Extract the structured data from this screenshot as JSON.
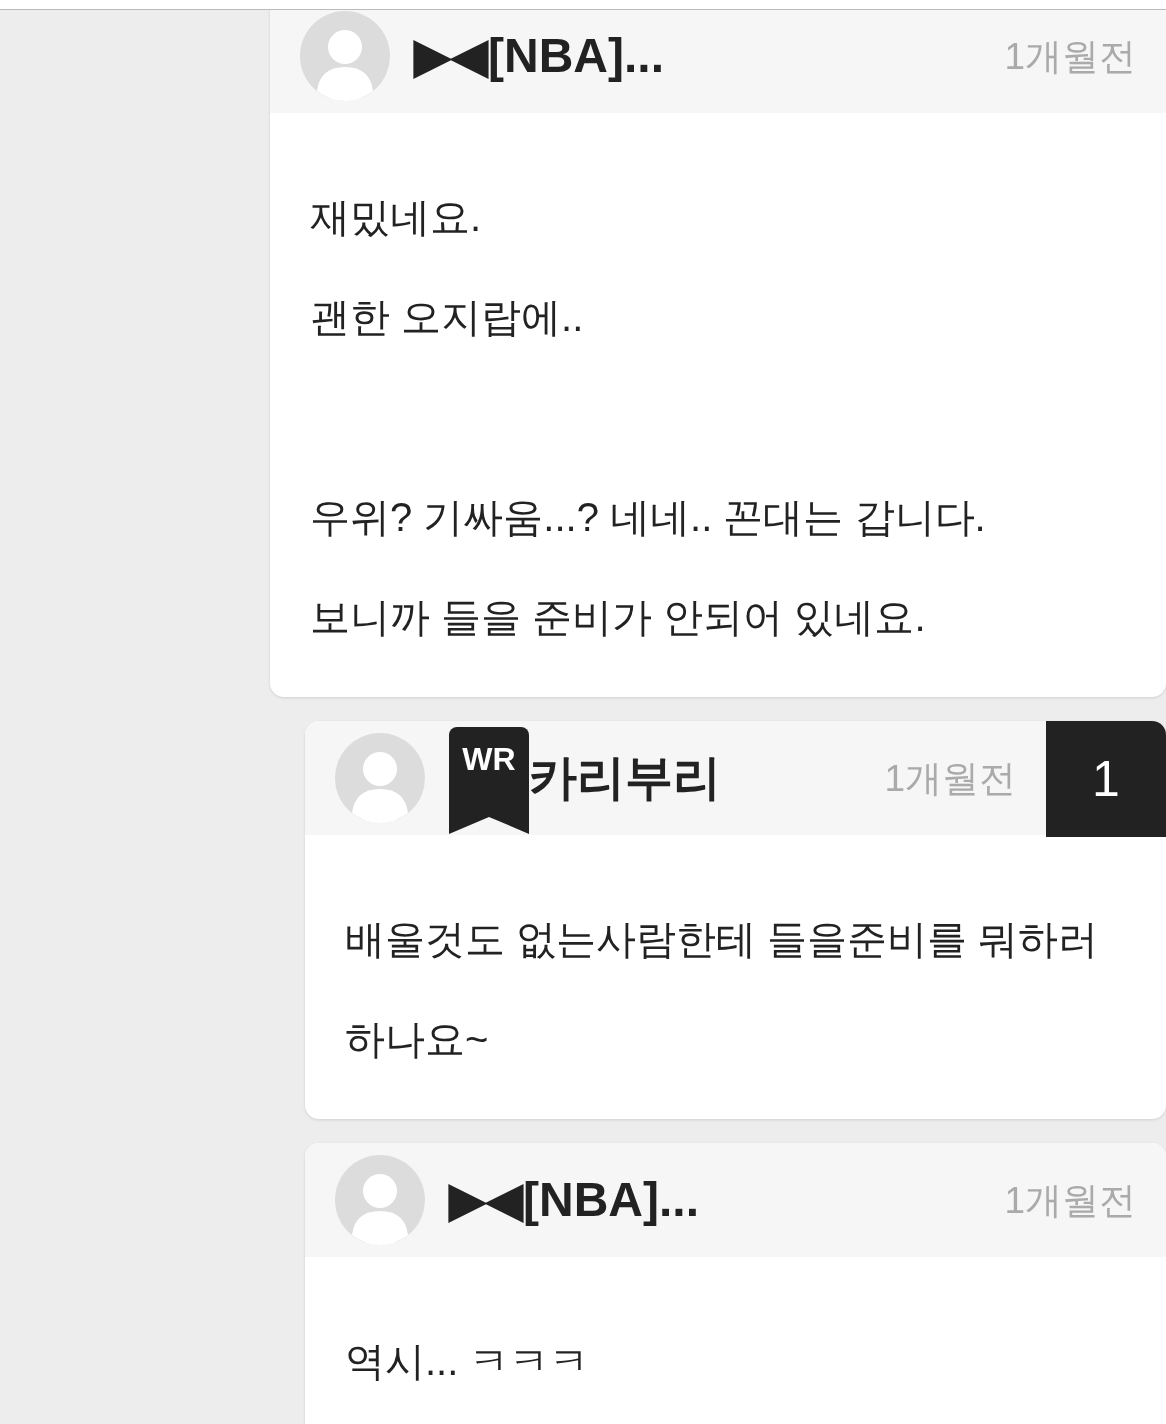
{
  "comments": [
    {
      "reply": false,
      "author": "▶◀[NBA]...",
      "time": "1개월전",
      "body": [
        [
          "재밌네요.",
          "괜한 오지랍에.."
        ],
        [
          "우위? 기싸움...? 네네.. 꼰대는 갑니다.",
          "보니까 들을 준비가 안되어 있네요."
        ]
      ]
    },
    {
      "reply": true,
      "author": "카리부리",
      "badge": "WR",
      "time": "1개월전",
      "reply_count": "1",
      "body": [
        [
          "배울것도 없는사람한테 들을준비를 뭐하러하나요~"
        ]
      ]
    },
    {
      "reply": true,
      "author": "▶◀[NBA]...",
      "time": "1개월전",
      "body": [
        [
          "역시... ㅋㅋㅋ"
        ]
      ]
    }
  ]
}
